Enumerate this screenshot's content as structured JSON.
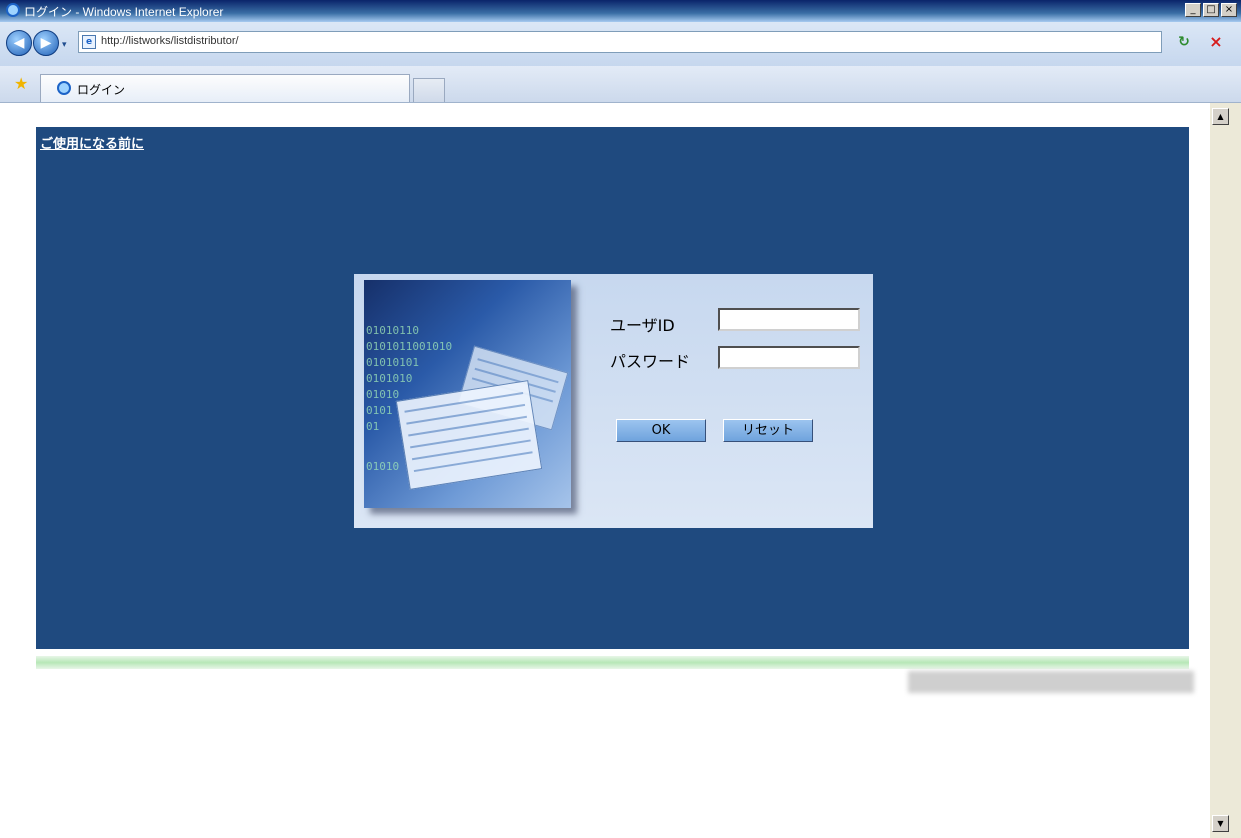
{
  "window": {
    "title": "ログイン - Windows Internet Explorer",
    "controls": {
      "minimize": "_",
      "maximize": "□",
      "close": "×"
    }
  },
  "toolbar": {
    "back_icon": "back-arrow-icon",
    "forward_icon": "forward-arrow-icon",
    "dropdown": "▾",
    "url": "http://listworks/listdistributor/",
    "refresh_glyph": "↻",
    "stop_glyph": "×"
  },
  "tabs": [
    {
      "label": "ログイン"
    }
  ],
  "page": {
    "before_use_link": "ご使用になる前に",
    "login": {
      "user_label": "ユーザID",
      "user_value": "",
      "password_label": "パスワード",
      "password_value": "",
      "ok_label": "OK",
      "reset_label": "リセット"
    },
    "image_text": [
      "01010110",
      "0101011001010",
      "01010101",
      "0101010",
      "01010",
      "0101",
      "01",
      "01010"
    ]
  },
  "colors": {
    "banner": "#1f4a7f",
    "login_panel": "#c7d8ef",
    "green_bar": "#b7e7b7"
  }
}
